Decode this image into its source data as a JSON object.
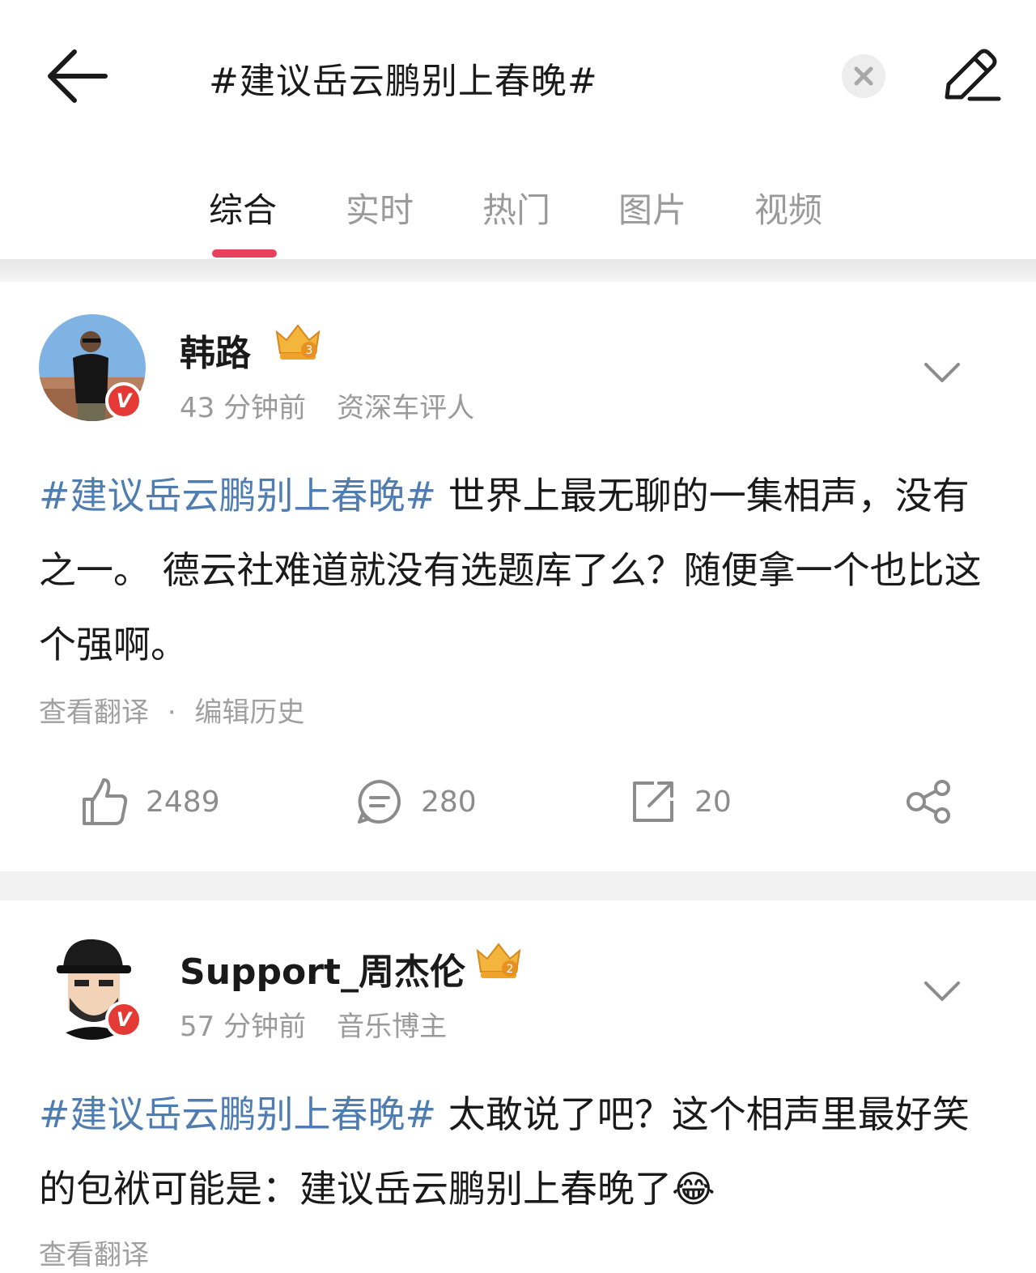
{
  "search": {
    "query": "#建议岳云鹏别上春晚#"
  },
  "tabs": [
    {
      "label": "综合"
    },
    {
      "label": "实时"
    },
    {
      "label": "热门"
    },
    {
      "label": "图片"
    },
    {
      "label": "视频"
    }
  ],
  "posts": [
    {
      "username": "韩路",
      "time": "43 分钟前",
      "role": "资深车评人",
      "hashtag": "#建议岳云鹏别上春晚#",
      "text": " 世界上最无聊的一集相声，没有之一。 德云社难道就没有选题库了么？随便拿一个也比这个强啊。",
      "link_translate": "查看翻译",
      "link_sep": "·",
      "link_history": "编辑历史",
      "likes": "2489",
      "comments": "280",
      "reposts": "20",
      "badge": "V",
      "crown_level": "3"
    },
    {
      "username": "Support_周杰伦",
      "time": "57 分钟前",
      "role": "音乐博主",
      "hashtag": "#建议岳云鹏别上春晚#",
      "text": " 太敢说了吧？这个相声里最好笑的包袱可能是：建议岳云鹏别上春晚了",
      "emoji": "😂",
      "link_translate": "查看翻译",
      "badge": "V",
      "crown_level": "2"
    }
  ],
  "colors": {
    "accent": "#e8415c",
    "hashtag": "#4f7db1",
    "verified": "#e53935"
  }
}
